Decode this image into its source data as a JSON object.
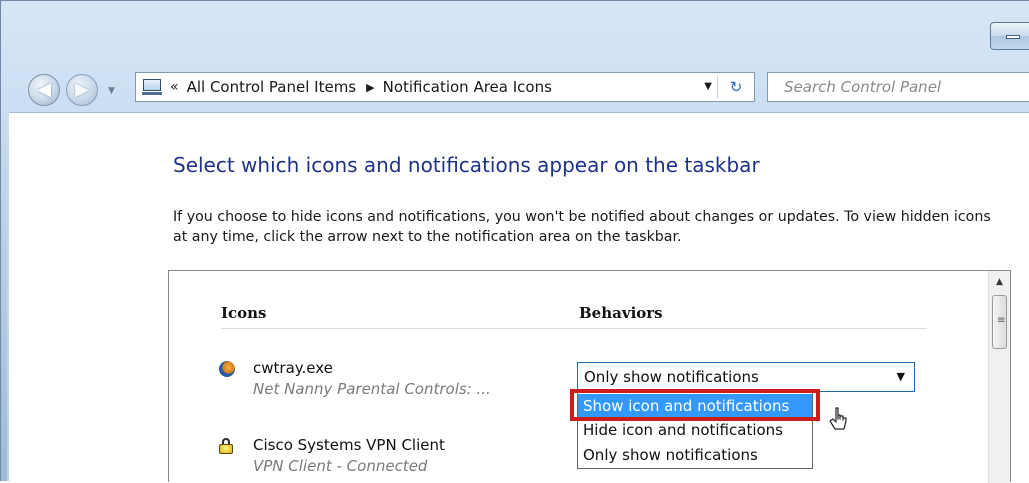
{
  "window": {
    "nav": {
      "back_glyph": "◀",
      "forward_glyph": "▶",
      "dropdown_glyph": "▼"
    },
    "address": {
      "icon": "control-panel-icon",
      "chevron": "«",
      "crumbs": [
        "All Control Panel Items",
        "Notification Area Icons"
      ],
      "separator": "▶",
      "dropdown_glyph": "▼",
      "refresh_glyph": "↻"
    },
    "search": {
      "placeholder": "Search Control Panel"
    }
  },
  "page": {
    "heading": "Select which icons and notifications appear on the taskbar",
    "description": "If you choose to hide icons and notifications, you won't be notified about changes or updates. To view hidden icons at any time, click the arrow next to the notification area on the taskbar."
  },
  "table": {
    "columns": {
      "icons": "Icons",
      "behaviors": "Behaviors"
    },
    "rows": [
      {
        "name": "cwtray.exe",
        "sub": "Net Nanny Parental Controls: ...",
        "icon": "cwtray-icon",
        "behavior": "Only show notifications"
      },
      {
        "name": "Cisco Systems VPN Client",
        "sub": "VPN Client - Connected",
        "icon": "padlock-icon"
      }
    ],
    "dropdown": {
      "selected": "Only show notifications",
      "arrow_glyph": "▼",
      "options": [
        "Show icon and notifications",
        "Hide icon and notifications",
        "Only show notifications"
      ],
      "highlighted_index": 0
    }
  },
  "scrollbar": {
    "up_glyph": "▲",
    "grip_glyph": "≡"
  },
  "colors": {
    "heading": "#1e3287",
    "selection": "#3399ff",
    "highlight_box": "#cc1c1c"
  }
}
